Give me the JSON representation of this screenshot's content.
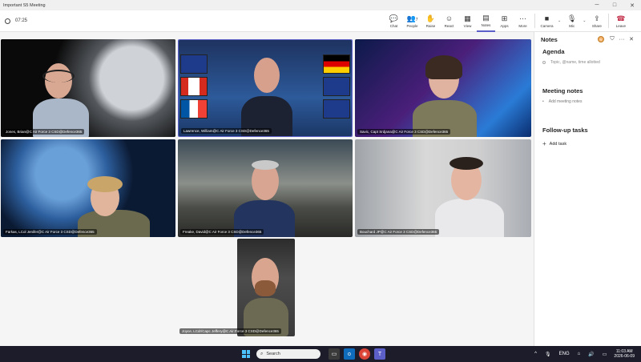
{
  "window": {
    "title": "Important S5 Meeting",
    "minimize": "─",
    "maximize": "□",
    "close": "✕"
  },
  "toolbar": {
    "timer": "07:25",
    "buttons": [
      {
        "label": "Chat",
        "icon": "chat-icon"
      },
      {
        "label": "People",
        "icon": "people-icon",
        "count": "7"
      },
      {
        "label": "Raise",
        "icon": "raise-hand-icon"
      },
      {
        "label": "React",
        "icon": "react-icon"
      },
      {
        "label": "View",
        "icon": "view-icon"
      },
      {
        "label": "Notes",
        "icon": "notes-icon"
      },
      {
        "label": "Apps",
        "icon": "apps-icon"
      },
      {
        "label": "More",
        "icon": "more-icon"
      }
    ],
    "camera": "Camera",
    "mic": "Mic",
    "share": "Share",
    "leave": "Leave"
  },
  "participants": [
    {
      "name": "Jones, Brian@C Air Force 3 CSD@Defence365"
    },
    {
      "name": "Lawrence, William@C Air Force 3 CSD@Defence365"
    },
    {
      "name": "Savic, Capt Srdjana@C Air Force 3 CSD@Defence365"
    },
    {
      "name": "Farkas, LCol Jenifer@C Air Force 3 CSD@Defence365"
    },
    {
      "name": "Freake, David@C Air Force 3 CSD@Defence365"
    },
    {
      "name": "Bouchard JP@C Air Force 3 CSD@Defence365"
    },
    {
      "name": "Joyce, LCdr/Capc Jeffery@C Air Force 3 CSD@Defence365"
    }
  ],
  "notes": {
    "title": "Notes",
    "agenda_title": "Agenda",
    "agenda_placeholder": "Topic, @name, time allotted",
    "meeting_notes_title": "Meeting notes",
    "add_meeting_notes": "Add meeting notes",
    "followup_title": "Follow-up tasks",
    "add_task": "Add task"
  },
  "taskbar": {
    "search": "Search",
    "language": "ENG",
    "time": "11:03 AM",
    "date": "2026-06-09"
  },
  "colors": {
    "accent": "#5b5fc7",
    "leave": "#c4314b",
    "taskbar": "#1c1c2b"
  }
}
